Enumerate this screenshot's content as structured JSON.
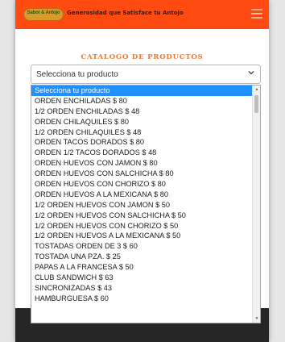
{
  "brand": {
    "logo_text": "Sabor & Antojo",
    "tagline": "Generosidad que Satisface tu Antojo",
    "accent_color": "#ff4a12"
  },
  "catalog": {
    "title": "CATALOGO DE PRODUCTOS",
    "select_value": "Selecciona tu producto",
    "chevron_icon": "chevron-down-icon"
  },
  "dropdown": {
    "selected_index": 0,
    "options": [
      "Selecciona tu producto",
      "ORDEN ENCHILADAS $ 80",
      "1/2 ORDEN ENCHILADAS $ 48",
      "ORDEN CHILAQUILES $ 80",
      "1/2 ORDEN CHILAQUILES $ 48",
      "ORDEN TACOS DORADOS $ 80",
      "ORDEN 1/2 TACOS DORADOS $ 48",
      "ORDEN HUEVOS CON JAMON $ 80",
      "ORDEN HUEVOS CON SALCHICHA $ 80",
      "ORDEN HUEVOS CON CHORIZO $ 80",
      "ORDEN HUEVOS A LA MEXICANA $ 80",
      "1/2 ORDEN HUEVOS CON JAMON $ 50",
      "1/2 ORDEN HUEVOS CON SALCHICHA $ 50",
      "1/2 ORDEN HUEVOS CON CHORIZO $ 50",
      "1/2 ORDEN HUEVOS A LA MEXICANA $ 50",
      "TOSTADAS ORDEN DE 3 $ 60",
      "TOSTADA UNA PZA. $ 25",
      "PAPAS A LA FRANCESA $ 50",
      "CLUB SANDWICH $ 63",
      "SINCRONIZADAS $ 43",
      "HAMBURGUESA $ 60"
    ]
  }
}
